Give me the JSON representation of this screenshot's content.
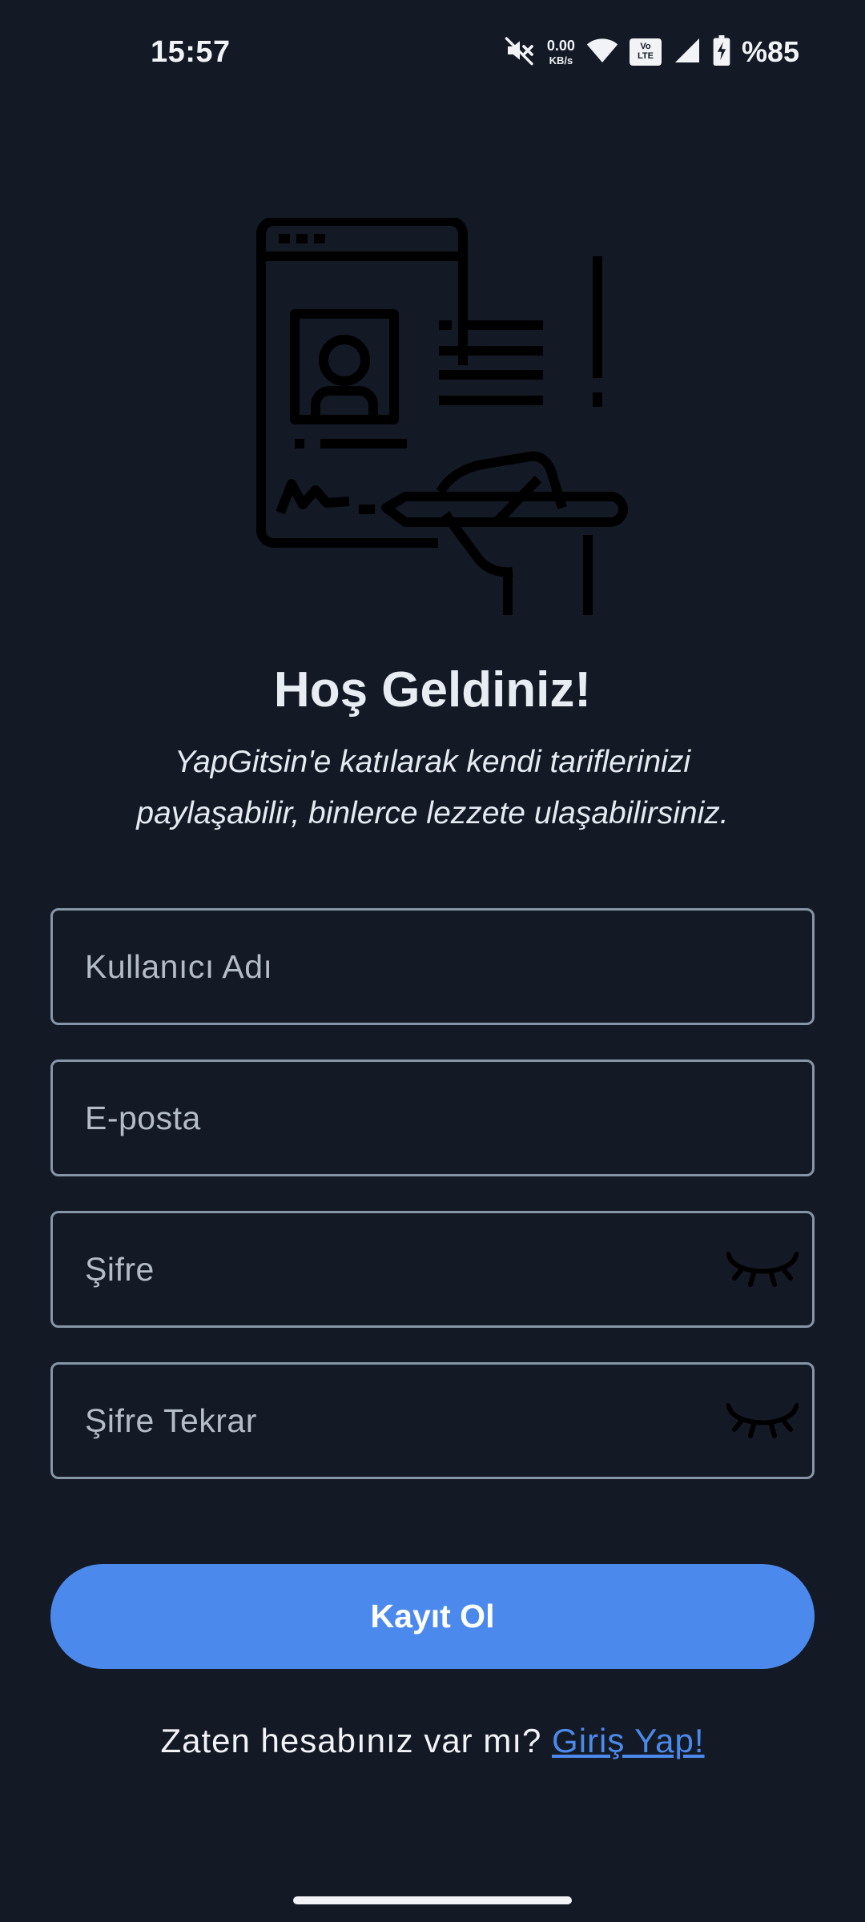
{
  "status_bar": {
    "time": "15:57",
    "net_speed_value": "0.00",
    "net_speed_unit": "KB/s",
    "volte_top": "Vo",
    "volte_bottom": "LTE",
    "battery_percent": "%85"
  },
  "welcome": {
    "title": "Hoş Geldiniz!",
    "subtitle_line1": "YapGitsin'e katılarak kendi tariflerinizi",
    "subtitle_line2": "paylaşabilir, binlerce lezzete ulaşabilirsiniz."
  },
  "form": {
    "username_placeholder": "Kullanıcı Adı",
    "email_placeholder": "E-posta",
    "password_placeholder": "Şifre",
    "password_repeat_placeholder": "Şifre Tekrar"
  },
  "actions": {
    "register_label": "Kayıt Ol",
    "login_prompt": "Zaten hesabınız var mı?",
    "login_link": "Giriş Yap!"
  },
  "icons": {
    "illustration": "registration-form-illustration-icon",
    "password_toggle": "eye-closed-icon"
  },
  "colors": {
    "background": "#131a25",
    "accent": "#4b8aec",
    "field_border": "#8796a6"
  }
}
